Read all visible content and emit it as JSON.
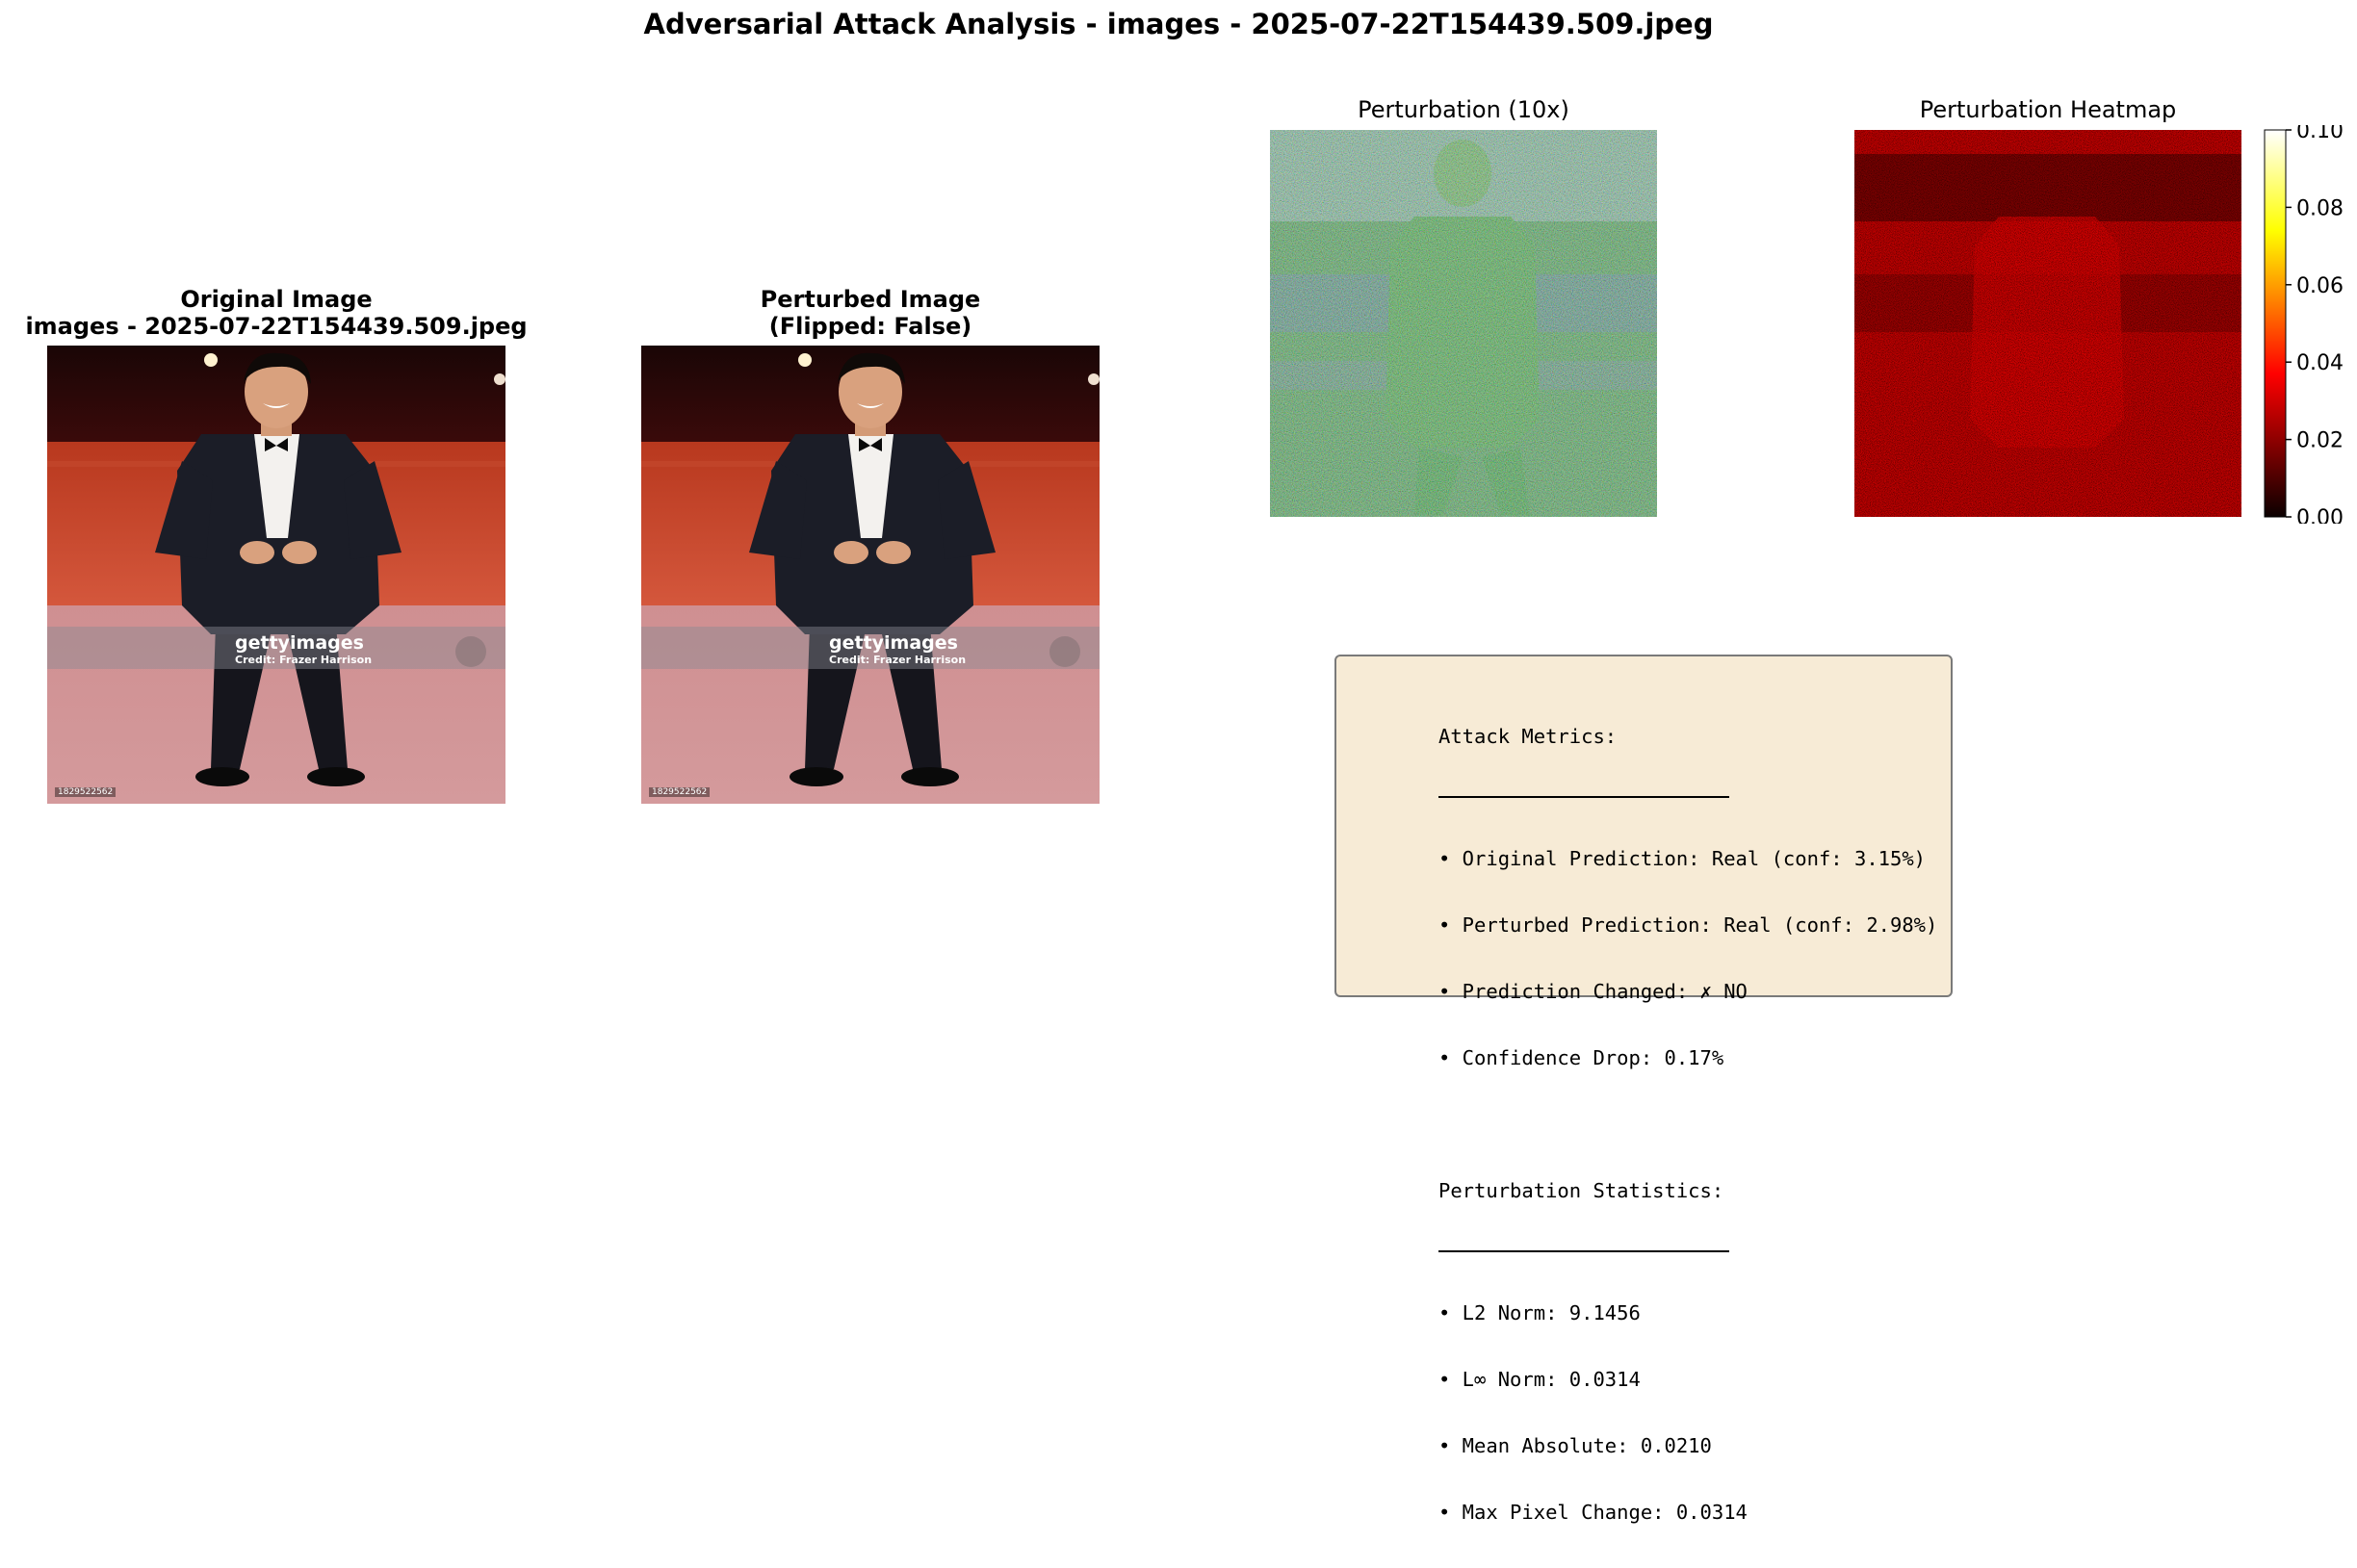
{
  "suptitle": "Adversarial Attack Analysis - images - 2025-07-22T154439.509.jpeg",
  "panels": {
    "original": {
      "title_line1": "Original Image",
      "title_line2": "images - 2025-07-22T154439.509.jpeg"
    },
    "perturbed": {
      "title_line1": "Perturbed Image",
      "title_line2": "(Flipped: False)"
    },
    "perturbation": {
      "title": "Perturbation (10x)"
    },
    "heatmap": {
      "title": "Perturbation Heatmap"
    }
  },
  "photo": {
    "watermark_brand": "gettyimages",
    "watermark_credit": "Credit: Frazer Harrison",
    "image_id": "1829522562"
  },
  "colors": {
    "metrics_bg": "#f7ebd6",
    "heatmap_base": "#c00000"
  },
  "chart_data": {
    "type": "heatmap",
    "title": "Perturbation Heatmap",
    "colormap": "hot",
    "vmin": 0.0,
    "vmax": 0.1,
    "colorbar_ticks": [
      "0.00",
      "0.02",
      "0.04",
      "0.06",
      "0.08",
      "0.10"
    ]
  },
  "metrics": {
    "attack_header": "Attack Metrics:",
    "attack_lines": [
      "• Original Prediction: Real (conf: 3.15%)",
      "• Perturbed Prediction: Real (conf: 2.98%)",
      "• Prediction Changed: ✗ NO",
      "• Confidence Drop: 0.17%"
    ],
    "stats_header": "Perturbation Statistics:",
    "stats_lines": [
      "• L2 Norm: 9.1456",
      "• L∞ Norm: 0.0314",
      "• Mean Absolute: 0.0210",
      "• Max Pixel Change: 0.0314"
    ]
  }
}
